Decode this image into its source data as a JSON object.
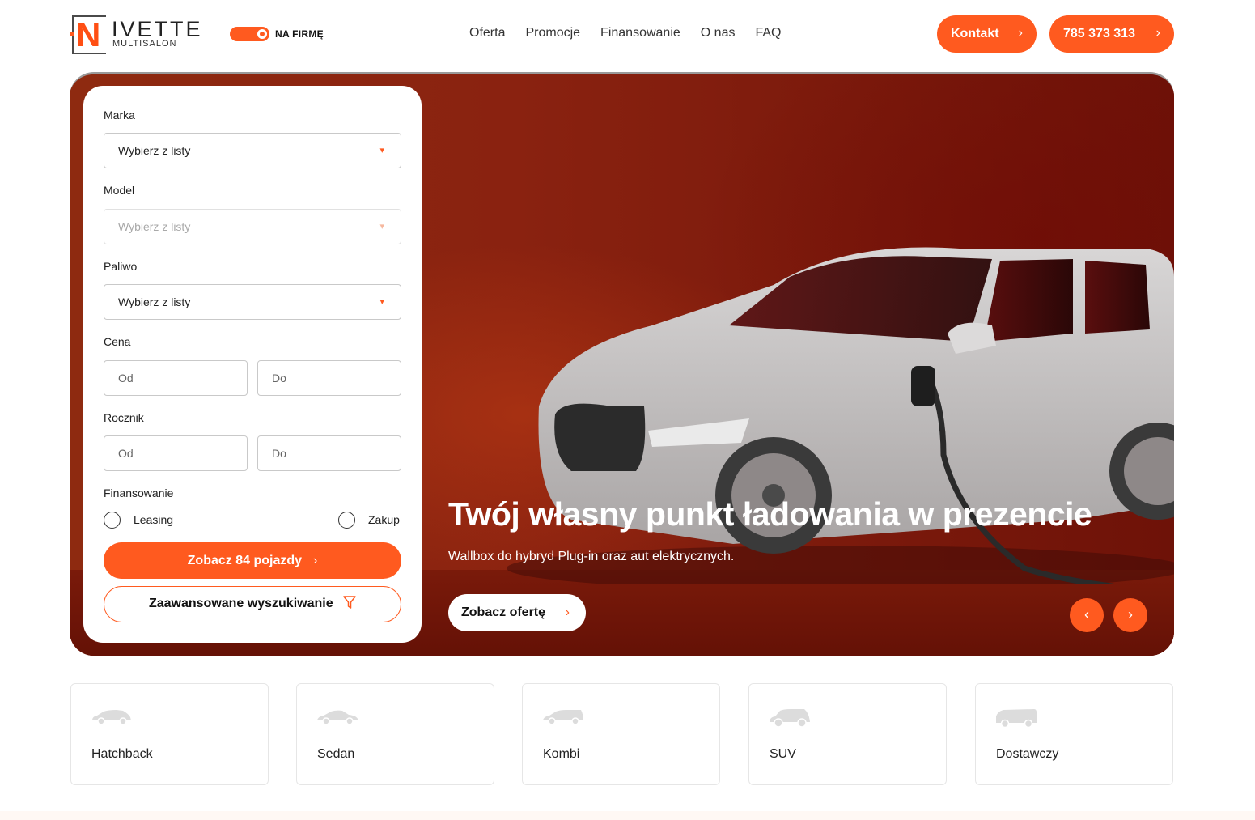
{
  "header": {
    "logo": {
      "letter": "N",
      "word": "IVETTE",
      "sub": "MULTISALON"
    },
    "toggle_label": "NA FIRMĘ",
    "nav": [
      "Oferta",
      "Promocje",
      "Finansowanie",
      "O nas",
      "FAQ"
    ],
    "contact_button": "Kontakt",
    "phone_button": "785 373 313"
  },
  "search": {
    "brand": {
      "label": "Marka",
      "value": "Wybierz z listy"
    },
    "model": {
      "label": "Model",
      "value": "Wybierz z listy"
    },
    "fuel": {
      "label": "Paliwo",
      "value": "Wybierz z listy"
    },
    "price": {
      "label": "Cena",
      "from_placeholder": "Od",
      "to_placeholder": "Do"
    },
    "year": {
      "label": "Rocznik",
      "from_placeholder": "Od",
      "to_placeholder": "Do"
    },
    "financing": {
      "label": "Finansowanie",
      "options": [
        "Leasing",
        "Zakup"
      ]
    },
    "submit_label": "Zobacz 84 pojazdy",
    "advanced_label": "Zaawansowane wyszukiwanie"
  },
  "hero": {
    "title": "Twój własny punkt ładowania w prezencie",
    "subtitle": "Wallbox do hybryd Plug-in oraz aut elektrycznych.",
    "cta_label": "Zobacz ofertę"
  },
  "body_types": [
    {
      "label": "Hatchback",
      "icon": "hatchback-icon"
    },
    {
      "label": "Sedan",
      "icon": "sedan-icon"
    },
    {
      "label": "Kombi",
      "icon": "kombi-icon"
    },
    {
      "label": "SUV",
      "icon": "suv-icon"
    },
    {
      "label": "Dostawczy",
      "icon": "van-icon"
    }
  ],
  "colors": {
    "accent": "#ff5a1f",
    "hero_red": "#8a220f"
  }
}
